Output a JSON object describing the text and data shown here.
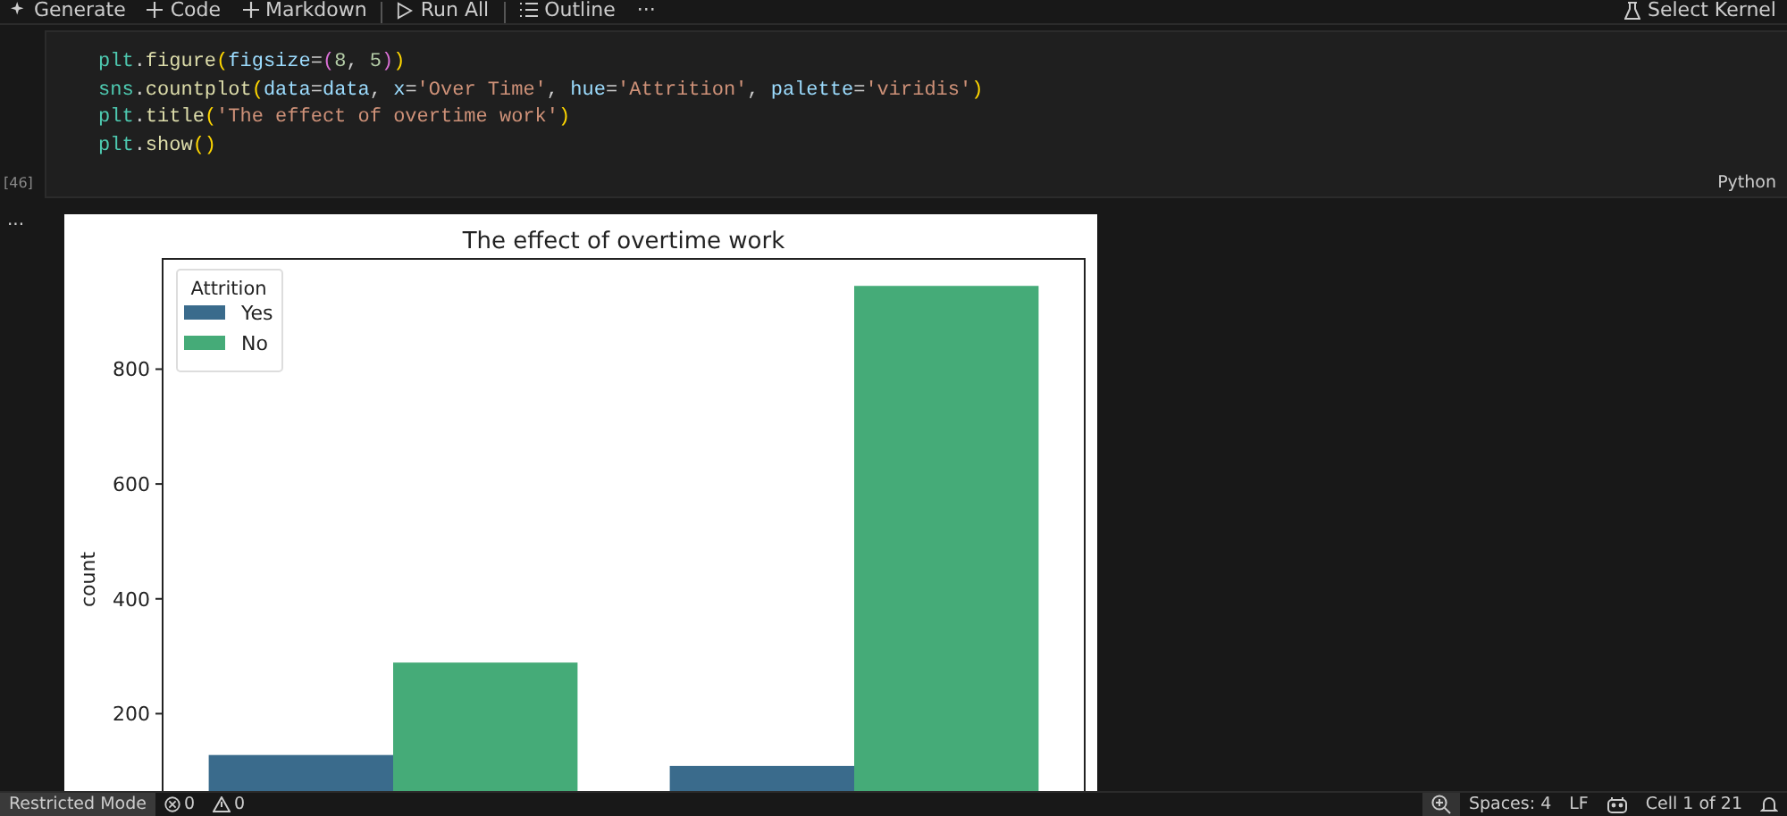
{
  "toolbar": {
    "items": [
      {
        "kind": "sparkle",
        "label": "Generate"
      },
      {
        "kind": "plus",
        "label": "Code"
      },
      {
        "kind": "plus",
        "label": "Markdown"
      },
      {
        "kind": "run",
        "label": "Run All"
      },
      {
        "kind": "outline",
        "label": "Outline"
      },
      {
        "kind": "more",
        "label": "···"
      }
    ],
    "kernel": {
      "label": "Select Kernel"
    }
  },
  "cell": {
    "execution_count": "[46]",
    "language": "Python",
    "lines": [
      [
        {
          "kind": "obj",
          "text": "plt"
        },
        {
          "kind": "punct",
          "text": "."
        },
        {
          "kind": "fn",
          "text": "figure"
        },
        {
          "kind": "br1",
          "text": "("
        },
        {
          "kind": "param",
          "text": "figsize"
        },
        {
          "kind": "punct",
          "text": "="
        },
        {
          "kind": "br2",
          "text": "("
        },
        {
          "kind": "num",
          "text": "8"
        },
        {
          "kind": "punct",
          "text": ", "
        },
        {
          "kind": "num",
          "text": "5"
        },
        {
          "kind": "br2",
          "text": ")"
        },
        {
          "kind": "br1",
          "text": ")"
        }
      ],
      [
        {
          "kind": "obj",
          "text": "sns"
        },
        {
          "kind": "punct",
          "text": "."
        },
        {
          "kind": "fn",
          "text": "countplot"
        },
        {
          "kind": "br1",
          "text": "("
        },
        {
          "kind": "param",
          "text": "data"
        },
        {
          "kind": "punct",
          "text": "="
        },
        {
          "kind": "param",
          "text": "data"
        },
        {
          "kind": "punct",
          "text": ", "
        },
        {
          "kind": "param",
          "text": "x"
        },
        {
          "kind": "punct",
          "text": "="
        },
        {
          "kind": "str",
          "text": "'Over Time'"
        },
        {
          "kind": "punct",
          "text": ", "
        },
        {
          "kind": "param",
          "text": "hue"
        },
        {
          "kind": "punct",
          "text": "="
        },
        {
          "kind": "str",
          "text": "'Attrition'"
        },
        {
          "kind": "punct",
          "text": ", "
        },
        {
          "kind": "param",
          "text": "palette"
        },
        {
          "kind": "punct",
          "text": "="
        },
        {
          "kind": "str",
          "text": "'viridis'"
        },
        {
          "kind": "br1",
          "text": ")"
        }
      ],
      [
        {
          "kind": "obj",
          "text": "plt"
        },
        {
          "kind": "punct",
          "text": "."
        },
        {
          "kind": "fn",
          "text": "title"
        },
        {
          "kind": "br1",
          "text": "("
        },
        {
          "kind": "str",
          "text": "'The effect of overtime work'"
        },
        {
          "kind": "br1",
          "text": ")"
        }
      ],
      [
        {
          "kind": "obj",
          "text": "plt"
        },
        {
          "kind": "punct",
          "text": "."
        },
        {
          "kind": "fn",
          "text": "show"
        },
        {
          "kind": "br1",
          "text": "()"
        }
      ]
    ]
  },
  "output": {
    "more": "...",
    "chart_data": {
      "type": "bar",
      "title": "The effect of overtime work",
      "legend": {
        "title": "Attrition"
      },
      "ylabel": "count",
      "ylim": [
        0,
        992
      ],
      "yticks": [
        200,
        400,
        600,
        800
      ],
      "series": [
        {
          "name": "Yes",
          "color": "#3a6b8c",
          "values": [
            128,
            109
          ]
        },
        {
          "name": "No",
          "color": "#45ab78",
          "values": [
            289,
            945
          ]
        }
      ]
    }
  },
  "status_bar": {
    "left": [
      {
        "kind": "mode",
        "label": "Restricted Mode"
      },
      {
        "kind": "errors",
        "label": "0"
      },
      {
        "kind": "warnings",
        "label": "0"
      }
    ],
    "right": [
      {
        "kind": "zoom"
      },
      {
        "kind": "text",
        "label": "Spaces: 4"
      },
      {
        "kind": "text",
        "label": "LF"
      },
      {
        "kind": "copilot"
      },
      {
        "kind": "text",
        "label": "Cell 1 of 21"
      },
      {
        "kind": "bell"
      }
    ]
  }
}
